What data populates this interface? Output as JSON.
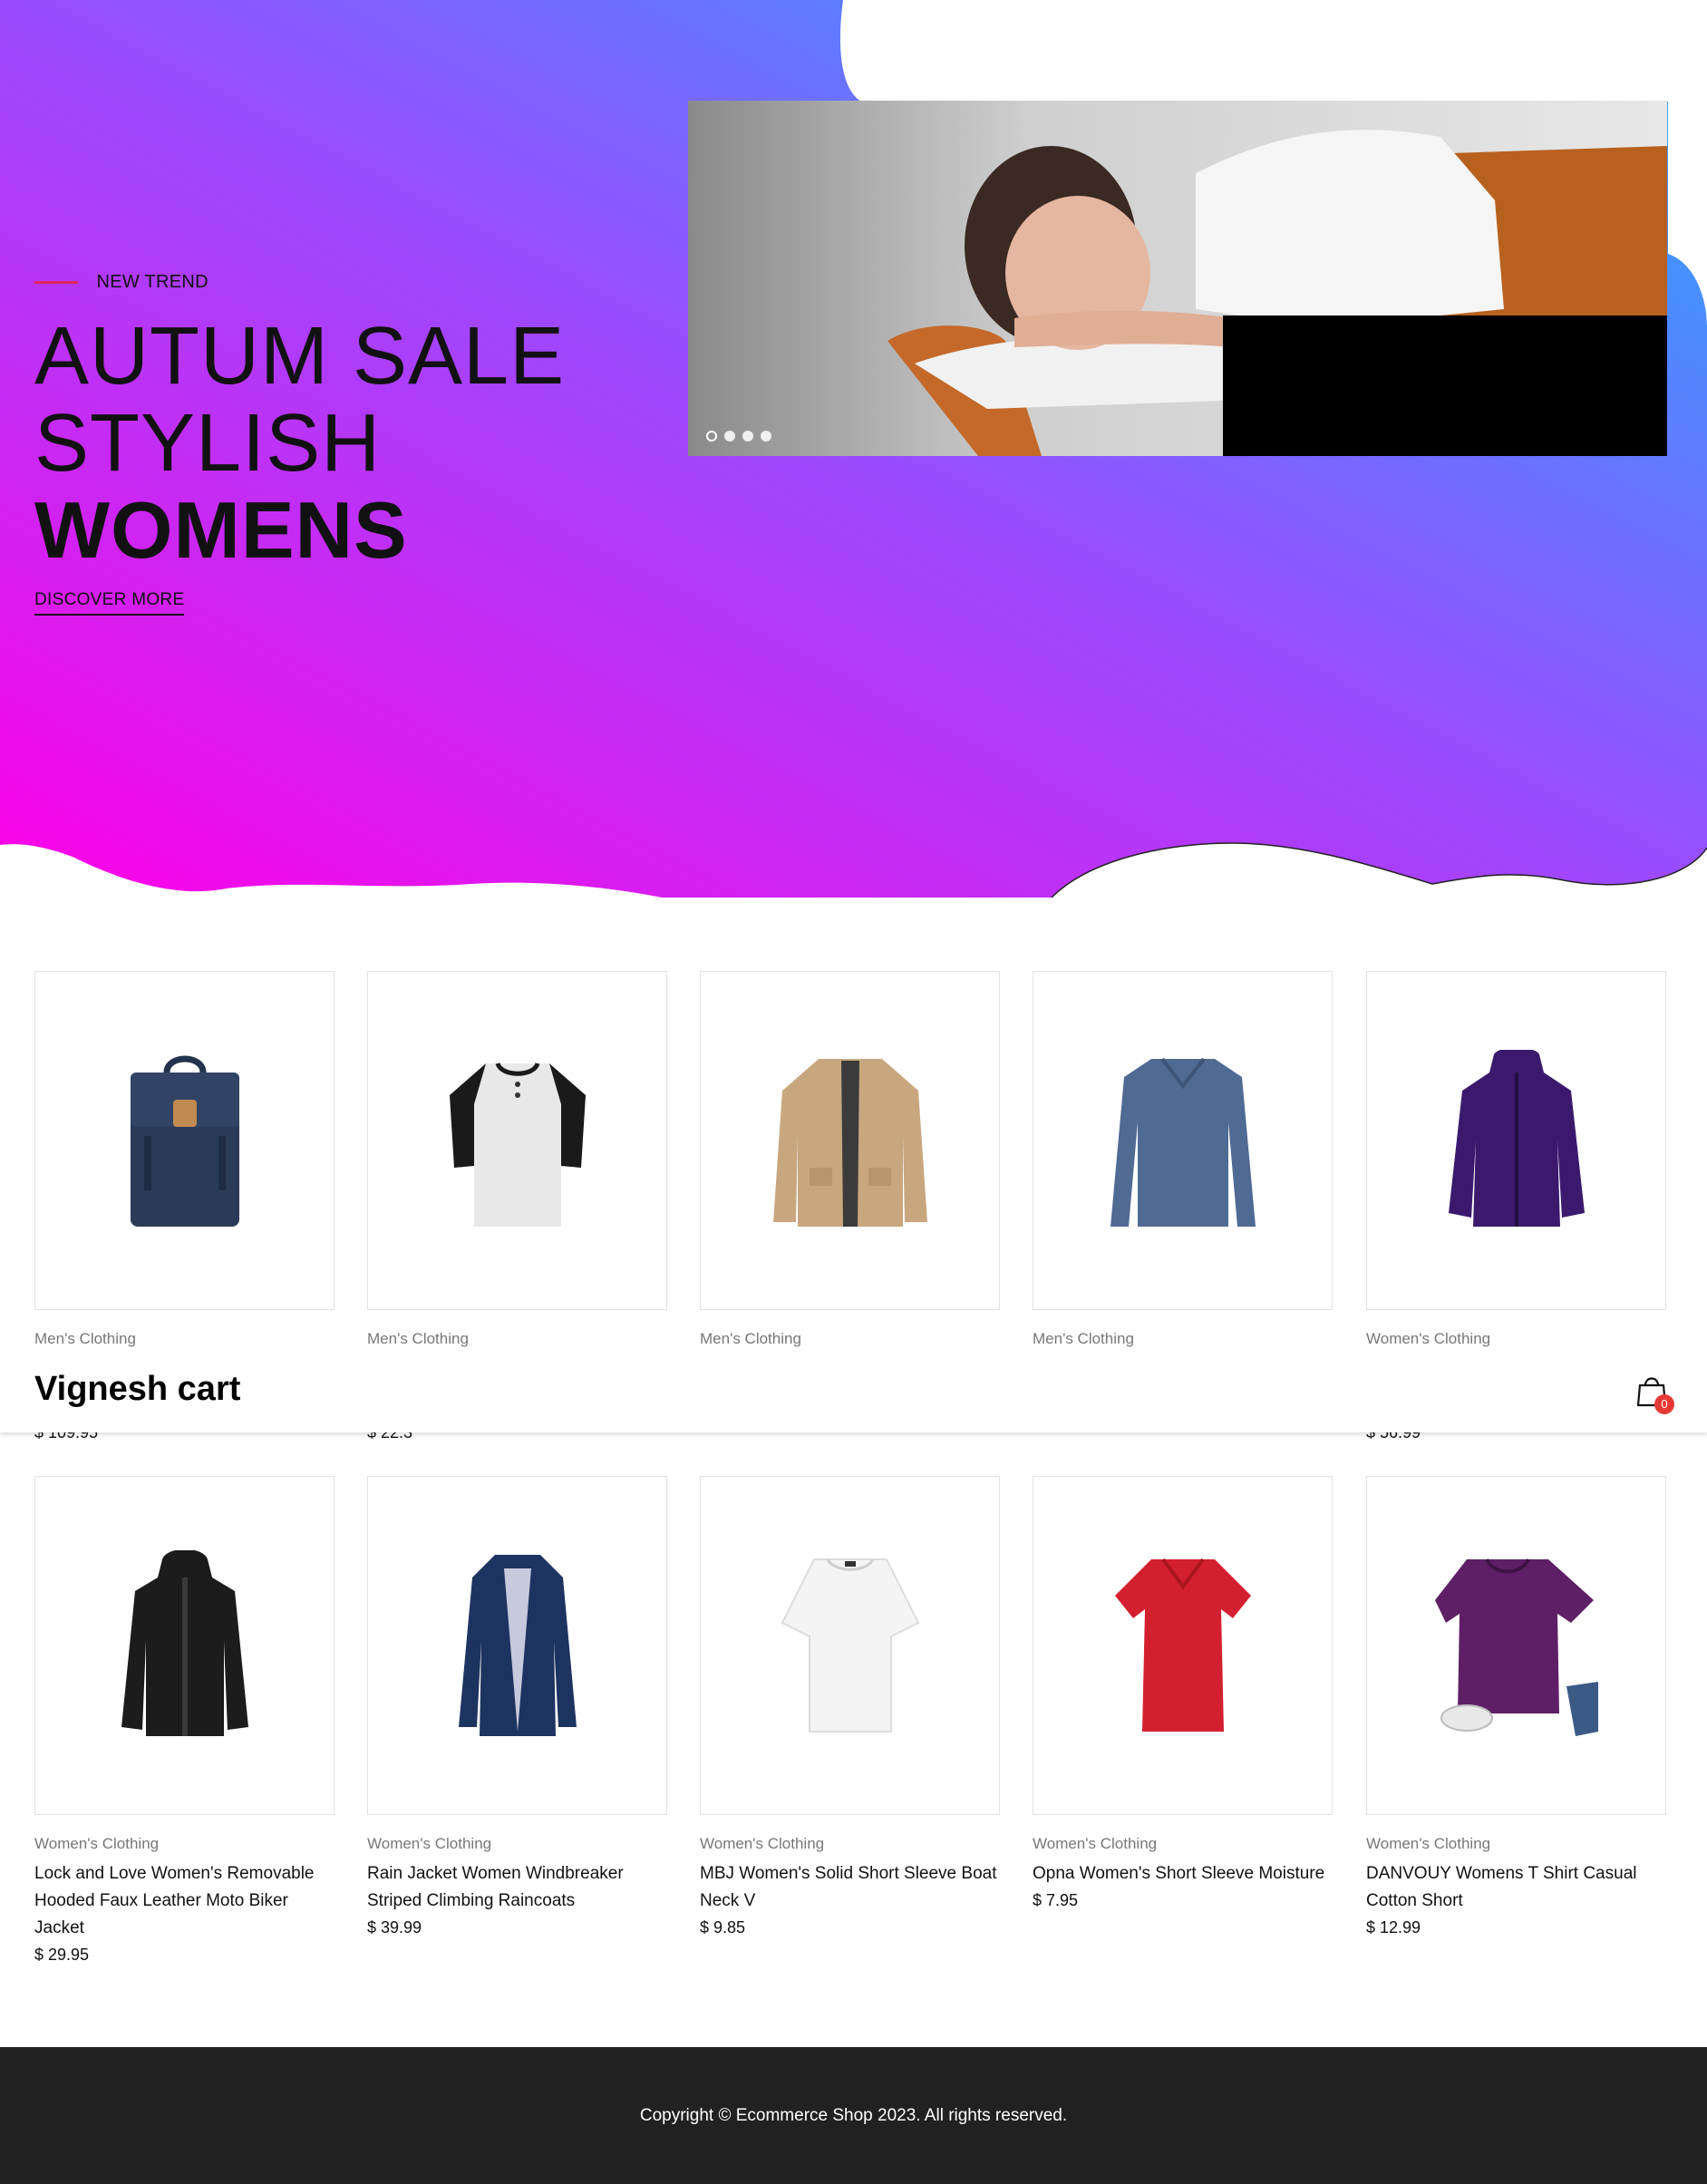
{
  "hero": {
    "trend_label": "NEW TREND",
    "line1": "AUTUM SALE",
    "line2": "STYLISH",
    "line3": "WOMENS",
    "cta": "DISCOVER MORE",
    "gradient": [
      "#ff00e6",
      "#1fb0ff"
    ],
    "slider": {
      "dot_count": 4,
      "active_index": 0
    }
  },
  "header": {
    "brand": "Vignesh cart",
    "cart_count": "0",
    "badge_color": "#e53935"
  },
  "products": [
    {
      "category": "Men's Clothing",
      "title": "",
      "price": "$ 109.95",
      "icon": "backpack-icon"
    },
    {
      "category": "Men's Clothing",
      "title": "",
      "price": "$ 22.3",
      "icon": "henley-tshirt-icon"
    },
    {
      "category": "Men's Clothing",
      "title": "",
      "price": "",
      "icon": "cotton-jacket-icon"
    },
    {
      "category": "Men's Clothing",
      "title": "",
      "price": "",
      "icon": "slim-fit-tshirt-icon"
    },
    {
      "category": "Women's Clothing",
      "title": "",
      "price": "$ 56.99",
      "icon": "snowboard-jacket-icon"
    },
    {
      "category": "Women's Clothing",
      "title": "Lock and Love Women's Removable Hooded Faux Leather Moto Biker Jacket",
      "price": "$ 29.95",
      "icon": "leather-jacket-icon"
    },
    {
      "category": "Women's Clothing",
      "title": "Rain Jacket Women Windbreaker Striped Climbing Raincoats",
      "price": "$ 39.99",
      "icon": "rain-jacket-icon"
    },
    {
      "category": "Women's Clothing",
      "title": "MBJ Women's Solid Short Sleeve Boat Neck V",
      "price": "$ 9.85",
      "icon": "white-top-icon"
    },
    {
      "category": "Women's Clothing",
      "title": "Opna Women's Short Sleeve Moisture",
      "price": "$ 7.95",
      "icon": "red-tshirt-icon"
    },
    {
      "category": "Women's Clothing",
      "title": "DANVOUY Womens T Shirt Casual Cotton Short",
      "price": "$ 12.99",
      "icon": "purple-tshirt-icon"
    }
  ],
  "footer": {
    "copyright": "Copyright © Ecommerce Shop 2023. All rights reserved."
  }
}
